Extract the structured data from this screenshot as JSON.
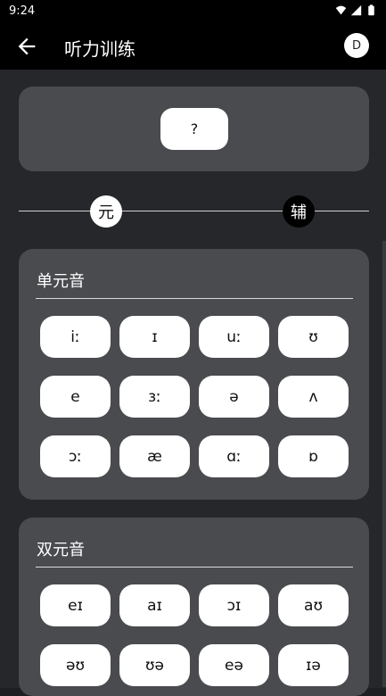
{
  "status_bar": {
    "time": "9:24",
    "icons": [
      "wifi-icon",
      "signal-icon",
      "battery-icon"
    ]
  },
  "app_bar": {
    "title": "听力训练",
    "avatar_letter": "D",
    "back_icon": "arrow-left-icon"
  },
  "question": {
    "label": "?"
  },
  "toggle": {
    "vowel_label": "元",
    "consonant_label": "辅",
    "selected": "vowel"
  },
  "sections": [
    {
      "title": "单元音",
      "symbols": [
        "iː",
        "ɪ",
        "uː",
        "ʊ",
        "e",
        "ɜː",
        "ə",
        "ʌ",
        "ɔː",
        "æ",
        "ɑː",
        "ɒ"
      ]
    },
    {
      "title": "双元音",
      "symbols": [
        "eɪ",
        "aɪ",
        "ɔɪ",
        "aʊ",
        "əʊ",
        "ʊə",
        "eə",
        "ɪə"
      ]
    }
  ],
  "colors": {
    "background": "#26272a",
    "card": "#4a4b4f",
    "bar": "#000000",
    "button": "#ffffff"
  }
}
